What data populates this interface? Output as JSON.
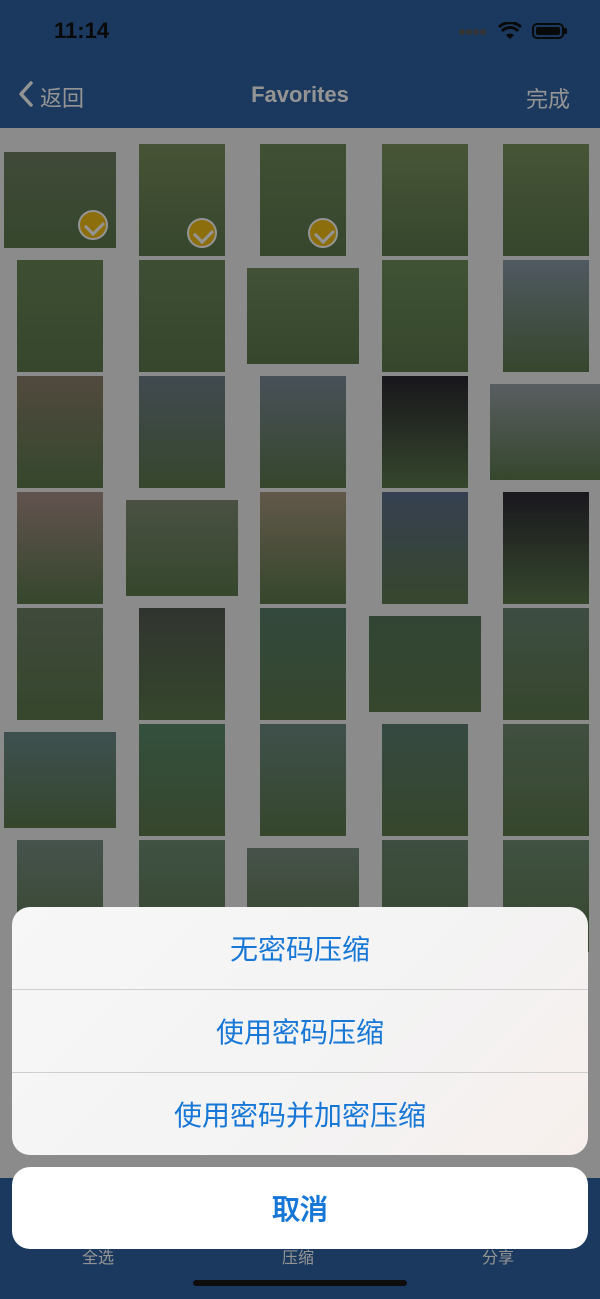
{
  "status": {
    "time": "11:14"
  },
  "nav": {
    "back_label": "返回",
    "title": "Favorites",
    "done_label": "完成"
  },
  "toolbar": {
    "select_all": "全选",
    "compress": "压缩",
    "share": "分享"
  },
  "action_sheet": {
    "options": [
      "无密码压缩",
      "使用密码压缩",
      "使用密码并加密压缩"
    ],
    "cancel": "取消"
  },
  "photos": [
    {
      "c": "#6f7f62",
      "selected": true
    },
    {
      "c": "#7b8f5d",
      "selected": true
    },
    {
      "c": "#6e8a5b",
      "selected": true
    },
    {
      "c": "#7c9460",
      "selected": false
    },
    {
      "c": "#7a925f",
      "selected": false
    },
    {
      "c": "#6a8758",
      "selected": false
    },
    {
      "c": "#6b875a",
      "selected": false
    },
    {
      "c": "#718c5f",
      "selected": false
    },
    {
      "c": "#6f8f5b",
      "selected": false
    },
    {
      "c": "#8a9aa8",
      "selected": false
    },
    {
      "c": "#8c7f6b",
      "selected": false
    },
    {
      "c": "#70808a",
      "selected": false
    },
    {
      "c": "#7d8c99",
      "selected": false
    },
    {
      "c": "#2a2730",
      "selected": false
    },
    {
      "c": "#9aa2a8",
      "selected": false
    },
    {
      "c": "#a98f88",
      "selected": false
    },
    {
      "c": "#7f8c73",
      "selected": false
    },
    {
      "c": "#a8987e",
      "selected": false
    },
    {
      "c": "#5e6f8c",
      "selected": false
    },
    {
      "c": "#2d2a34",
      "selected": false
    },
    {
      "c": "#6f8066",
      "selected": false
    },
    {
      "c": "#545a52",
      "selected": false
    },
    {
      "c": "#5a7e6a",
      "selected": false
    },
    {
      "c": "#56785b",
      "selected": false
    },
    {
      "c": "#6b8572",
      "selected": false
    },
    {
      "c": "#6a8b8a",
      "selected": false
    },
    {
      "c": "#5b8a6a",
      "selected": false
    },
    {
      "c": "#6d8b82",
      "selected": false
    },
    {
      "c": "#5e7f70",
      "selected": false
    },
    {
      "c": "#6f8a70",
      "selected": false
    },
    {
      "c": "#7a8f86",
      "selected": false
    },
    {
      "c": "#6e8e75",
      "selected": false
    },
    {
      "c": "#7a8e80",
      "selected": false
    },
    {
      "c": "#6a8870",
      "selected": false
    },
    {
      "c": "#6f8d72",
      "selected": false
    }
  ]
}
